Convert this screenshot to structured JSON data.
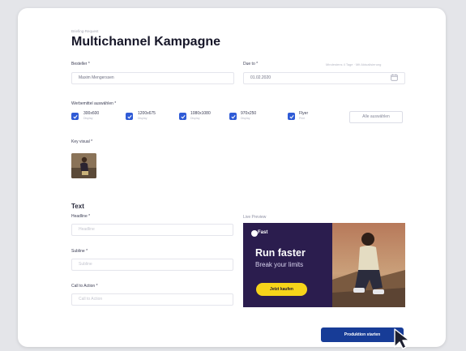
{
  "page": {
    "eyebrow": "Briefing-Request",
    "title": "Multichannel Kampagne"
  },
  "form": {
    "requester_label": "Besteller *",
    "requester_value": "Maxim Mengerssen",
    "due_label": "Due to *",
    "due_value": "01.02.2020",
    "due_hint": "Mindestens 4 Tage · Mit Aktualisierung",
    "media_label": "Werbemittel auswählen *",
    "media": [
      {
        "title": "300x600",
        "subtitle": "Display",
        "checked": true
      },
      {
        "title": "1200x675",
        "subtitle": "Display",
        "checked": true
      },
      {
        "title": "1080x1080",
        "subtitle": "Display",
        "checked": true
      },
      {
        "title": "970x250",
        "subtitle": "Display",
        "checked": true
      },
      {
        "title": "Flyer",
        "subtitle": "Print",
        "checked": true
      }
    ],
    "media_button": "Alle auswählen",
    "key_visual_label": "Key visual *",
    "text_section": "Text",
    "headline_label": "Headline *",
    "headline_placeholder": "Headline",
    "subline_label": "Subline *",
    "subline_placeholder": "Subline",
    "cta_label": "Call to Action *",
    "cta_placeholder": "Call to Action"
  },
  "preview": {
    "label": "Live Preview",
    "brand": "Fast",
    "headline": "Run faster",
    "subline": "Break your limits",
    "cta": "Jetzt kaufen",
    "bg_color": "#2b1d4e",
    "cta_color": "#f6d41a"
  },
  "actions": {
    "submit": "Produktion starten",
    "accent": "#173c97"
  },
  "icons": {
    "calendar": "calendar-icon",
    "check": "checkmark-icon",
    "cursor": "mouse-pointer-icon"
  }
}
